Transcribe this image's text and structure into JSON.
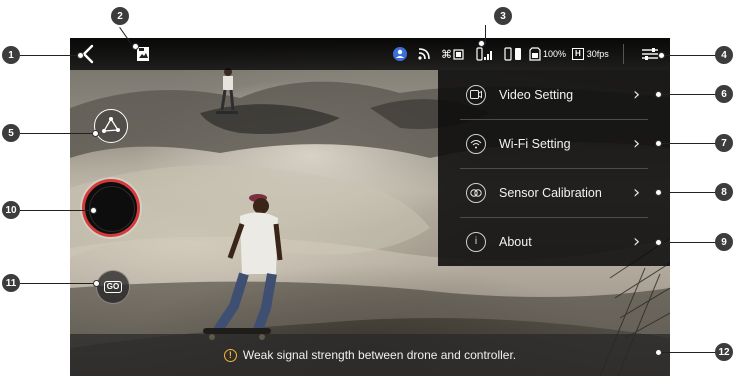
{
  "status_bar": {
    "battery_pct": "100%",
    "resolution_badge": "H",
    "framerate": "30fps",
    "icons": [
      "back-arrow-icon",
      "gallery-icon",
      "gps-icon",
      "wifi-signal-icon",
      "drone-signal-icon",
      "controller-signal-icon",
      "phone-battery-icon",
      "drone-battery-icon",
      "settings-sliders-icon"
    ]
  },
  "settings_menu": {
    "items": [
      {
        "label": "Video Setting",
        "icon": "video-icon"
      },
      {
        "label": "Wi-Fi Setting",
        "icon": "wifi-icon"
      },
      {
        "label": "Sensor Calibration",
        "icon": "calibration-icon"
      },
      {
        "label": "About",
        "icon": "info-icon"
      }
    ]
  },
  "controls": {
    "mode_badge": "GO",
    "path_icon": "flight-path-icon",
    "record_icon": "record-icon"
  },
  "warning": {
    "icon_glyph": "!",
    "text": "Weak signal strength between drone and controller."
  },
  "callouts": [
    "1",
    "2",
    "3",
    "4",
    "5",
    "6",
    "7",
    "8",
    "9",
    "10",
    "11",
    "12"
  ],
  "colors": {
    "record_ring": "#d33a3a",
    "warning_icon": "#f4b63a",
    "gps_blue": "#3a6fd8"
  }
}
